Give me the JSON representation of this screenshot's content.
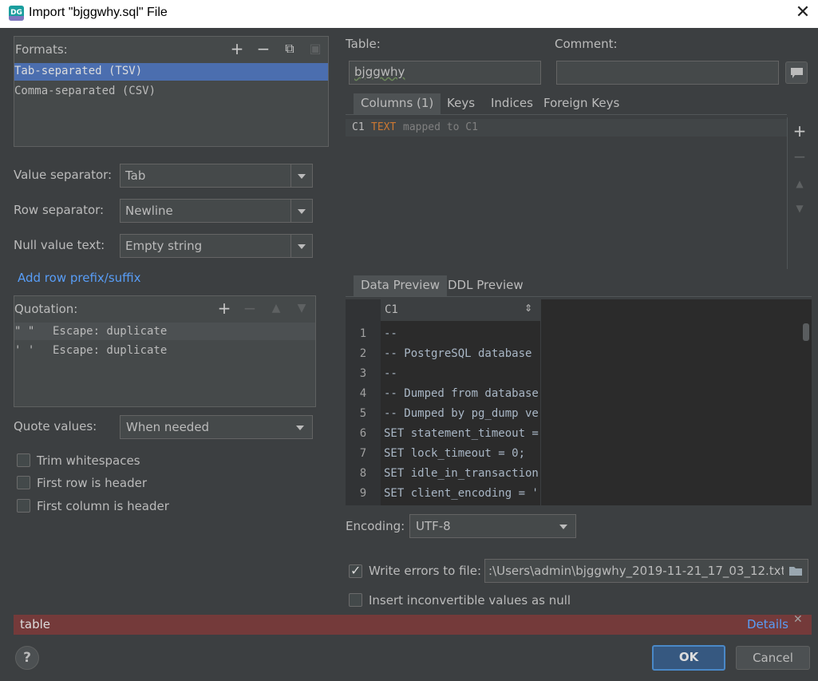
{
  "window": {
    "title": "Import \"bjggwhy.sql\" File",
    "logo": "DG"
  },
  "formats": {
    "label": "Formats:",
    "items": [
      "Tab-separated (TSV)",
      "Comma-separated (CSV)"
    ]
  },
  "separators": {
    "value_label": "Value separator:",
    "value": "Tab",
    "row_label": "Row separator:",
    "row": "Newline",
    "null_label": "Null value text:",
    "null": "Empty string"
  },
  "add_prefix_link": "Add row prefix/suffix",
  "quotation": {
    "label": "Quotation:",
    "rows": [
      {
        "chars": "\"  \"",
        "escape": "Escape: duplicate"
      },
      {
        "chars": "'  '",
        "escape": "Escape: duplicate"
      }
    ]
  },
  "quote_values": {
    "label": "Quote values:",
    "value": "When needed"
  },
  "checkboxes": {
    "trim": "Trim whitespaces",
    "first_row": "First row is header",
    "first_col": "First column is header"
  },
  "table": {
    "label": "Table:",
    "value": "bjggwhy",
    "comment_label": "Comment:",
    "comment_value": ""
  },
  "table_tabs": [
    "Columns (1)",
    "Keys",
    "Indices",
    "Foreign Keys"
  ],
  "columns": [
    {
      "name": "C1",
      "type": "TEXT",
      "mapping": "mapped to C1"
    }
  ],
  "preview_tabs": [
    "Data Preview",
    "DDL Preview"
  ],
  "preview": {
    "column_header": "C1",
    "rows": [
      {
        "n": "1",
        "text": "--"
      },
      {
        "n": "2",
        "text": "-- PostgreSQL database …"
      },
      {
        "n": "3",
        "text": "--"
      },
      {
        "n": "4",
        "text": "-- Dumped from database…"
      },
      {
        "n": "5",
        "text": "-- Dumped by pg_dump ve…"
      },
      {
        "n": "6",
        "text": "SET statement_timeout =…"
      },
      {
        "n": "7",
        "text": "SET lock_timeout = 0;"
      },
      {
        "n": "8",
        "text": "SET idle_in_transaction…"
      },
      {
        "n": "9",
        "text": "SET client_encoding = '…"
      }
    ]
  },
  "encoding": {
    "label": "Encoding:",
    "value": "UTF-8"
  },
  "errors": {
    "write_label": "Write errors to file:",
    "write_checked": true,
    "path": ":\\Users\\admin\\bjggwhy_2019-11-21_17_03_12.txt",
    "insert_label": "Insert inconvertible values as null",
    "insert_checked": false
  },
  "error_bar": {
    "message": "table",
    "details": "Details"
  },
  "buttons": {
    "help": "?",
    "ok": "OK",
    "cancel": "Cancel"
  },
  "colors": {
    "background": "#3c3f41",
    "selection": "#4b6eaf",
    "error_bar": "#743a3a",
    "link": "#589df6",
    "type_keyword": "#cc7832"
  }
}
